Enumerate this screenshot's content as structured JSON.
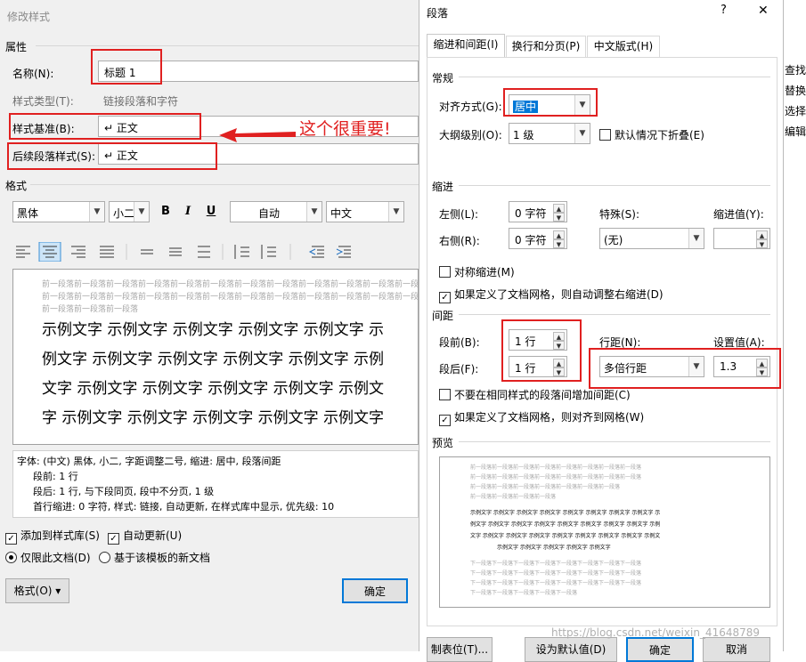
{
  "left_dialog": {
    "title": "修改样式",
    "properties_header": "属性",
    "name_label": "名称(N):",
    "name_value": "标题 1",
    "style_type_label": "样式类型(T):",
    "style_type_value": "链接段落和字符",
    "based_on_label": "样式基准(B):",
    "based_on_value": "↵ 正文",
    "following_label": "后续段落样式(S):",
    "following_value": "↵ 正文",
    "annotation": "这个很重要!",
    "format_header": "格式",
    "font_name": "黑体",
    "font_size": "小二",
    "bold": "B",
    "italic": "I",
    "underline": "U",
    "color": "自动",
    "script": "中文",
    "preview_ghost_lines": [
      "前一段落前一段落前一段落前一段落前一段落前一段落前一段落前一段落前一段落前一段落前一段落前一段落",
      "前一段落前一段落前一段落前一段落前一段落前一段落前一段落前一段落前一段落前一段落前一段落前一段落",
      "前一段落前一段落前一段落"
    ],
    "preview_sample_lines": [
      "示例文字 示例文字 示例文字 示例文字 示例文字 示",
      "例文字 示例文字 示例文字 示例文字 示例文字 示例",
      "文字 示例文字 示例文字 示例文字 示例文字 示例文",
      "字 示例文字 示例文字 示例文字 示例文字 示例文字"
    ],
    "description_lines": [
      "字体: (中文) 黑体, 小二, 字距调整二号, 缩进: 居中, 段落间距",
      "段前: 1 行",
      "段后: 1 行, 与下段同页, 段中不分页, 1 级",
      "首行缩进: 0 字符, 样式: 链接, 自动更新, 在样式库中显示, 优先级: 10"
    ],
    "add_to_gallery": "添加到样式库(S)",
    "auto_update": "自动更新(U)",
    "only_this_doc": "仅限此文档(D)",
    "new_docs_template": "基于该模板的新文档",
    "format_button": "格式(O) ▾",
    "ok_button": "确定"
  },
  "right_dialog": {
    "title": "段落",
    "help": "?",
    "close": "✕",
    "tabs": [
      "缩进和间距(I)",
      "换行和分页(P)",
      "中文版式(H)"
    ],
    "general_header": "常规",
    "alignment_label": "对齐方式(G):",
    "alignment_value": "居中",
    "outline_label": "大纲级别(O):",
    "outline_value": "1 级",
    "collapsed_default": "默认情况下折叠(E)",
    "indent_header": "缩进",
    "left_label": "左侧(L):",
    "left_value": "0 字符",
    "right_label": "右侧(R):",
    "right_value": "0 字符",
    "special_label": "特殊(S):",
    "special_value": "(无)",
    "indent_by_label": "缩进值(Y):",
    "indent_by_value": "",
    "mirror_indent": "对称缩进(M)",
    "auto_adjust_indent": "如果定义了文档网格，则自动调整右缩进(D)",
    "spacing_header": "间距",
    "before_label": "段前(B):",
    "before_value": "1 行",
    "after_label": "段后(F):",
    "after_value": "1 行",
    "line_spacing_label": "行距(N):",
    "line_spacing_value": "多倍行距",
    "at_label": "设置值(A):",
    "at_value": "1.3",
    "no_space_same_style": "不要在相同样式的段落间增加间距(C)",
    "snap_to_grid": "如果定义了文档网格，则对齐到网格(W)",
    "preview_header": "预览",
    "preview_prev_lines": [
      "前一段落前一段落前一段落前一段落前一段落前一段落前一段落前一段落",
      "前一段落前一段落前一段落前一段落前一段落前一段落前一段落前一段落",
      "前一段落前一段落前一段落前一段落前一段落前一段落前一段落",
      "前一段落前一段落前一段落前一段落"
    ],
    "preview_sample_lines": [
      "示例文字 示例文字 示例文字 示例文字 示例文字 示例文字 示例文字 示例文字 示",
      "例文字 示例文字 示例文字 示例文字 示例文字 示例文字 示例文字 示例文字 示例",
      "文字 示例文字 示例文字 示例文字 示例文字 示例文字 示例文字 示例文字 示例文",
      "示例文字 示例文字 示例文字 示例文字 示例文字"
    ],
    "preview_next_lines": [
      "下一段落下一段落下一段落下一段落下一段落下一段落下一段落下一段落",
      "下一段落下一段落下一段落下一段落下一段落下一段落下一段落下一段落",
      "下一段落下一段落下一段落下一段落下一段落下一段落下一段落下一段落",
      "下一段落下一段落下一段落下一段落下一段落"
    ],
    "tabs_button": "制表位(T)...",
    "set_default_button": "设为默认值(D)",
    "ok_button": "确定",
    "cancel_button": "取消",
    "watermark": "https://blog.csdn.net/weixin_41648789"
  },
  "background_menu": [
    "查找",
    "替换",
    "选择",
    "编辑"
  ]
}
